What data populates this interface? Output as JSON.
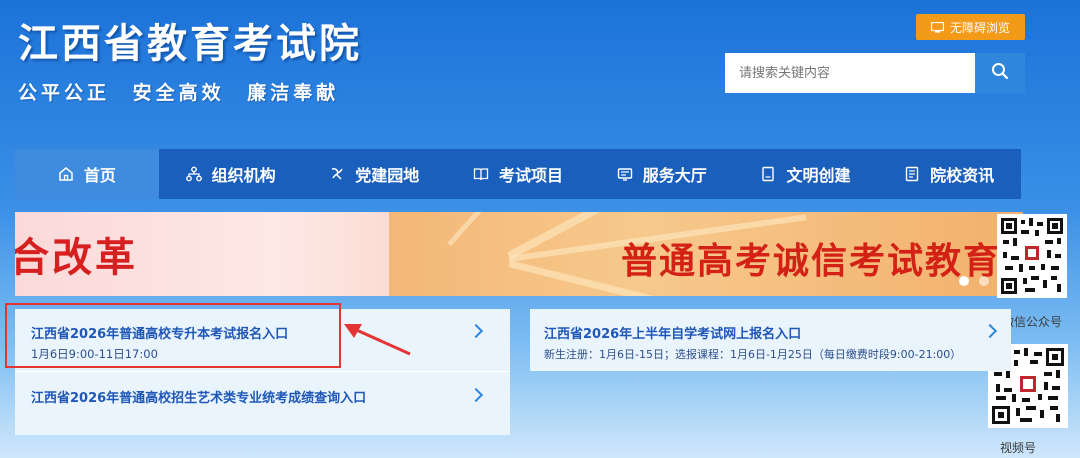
{
  "header": {
    "site_title": "江西省教育考试院",
    "slogan": [
      "公平公正",
      "安全高效",
      "廉洁奉献"
    ],
    "accessibility_label": "无障碍浏览",
    "search_placeholder": "请搜索关键内容"
  },
  "nav": {
    "items": [
      {
        "label": "首页",
        "icon": "home-icon",
        "active": true
      },
      {
        "label": "组织机构",
        "icon": "org-chart-icon",
        "active": false
      },
      {
        "label": "党建园地",
        "icon": "party-emblem-icon",
        "active": false
      },
      {
        "label": "考试项目",
        "icon": "book-icon",
        "active": false
      },
      {
        "label": "服务大厅",
        "icon": "service-icon",
        "active": false
      },
      {
        "label": "文明创建",
        "icon": "document-icon",
        "active": false
      },
      {
        "label": "院校资讯",
        "icon": "newspaper-icon",
        "active": false
      }
    ]
  },
  "banner": {
    "left_text": "合改革",
    "right_text": "普通高考诚信考试教育宣",
    "slide_count": 3,
    "active_slide": 1
  },
  "sidebar": {
    "qr_wechat_label": "微信公众号",
    "qr_video_label": "视频号"
  },
  "left_panel": {
    "items": [
      {
        "title": "江西省2026年普通高校专升本考试报名入口",
        "subtitle": "1月6日9:00-11日17:00"
      },
      {
        "title": "江西省2026年普通高校招生艺术类专业统考成绩查询入口",
        "subtitle": ""
      }
    ]
  },
  "right_panel": {
    "items": [
      {
        "title": "江西省2026年上半年自学考试网上报名入口",
        "subtitle": "新生注册：1月6日-15日；选报课程：1月6日-1月25日（每日缴费时段9:00-21:00）"
      }
    ]
  },
  "colors": {
    "nav_bg": "#1b5fbc",
    "nav_active": "#3e8be0",
    "accent_orange": "#f39a18",
    "link_blue": "#1f57b8",
    "highlight_red": "#e53434"
  }
}
